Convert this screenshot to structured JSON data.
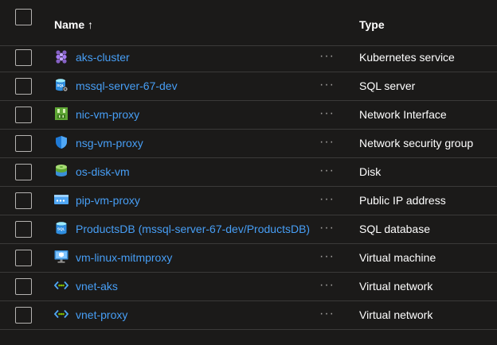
{
  "header": {
    "name_label": "Name",
    "sort_indicator": "↑",
    "type_label": "Type"
  },
  "more_glyph": "···",
  "rows": [
    {
      "name": "aks-cluster",
      "type": "Kubernetes service",
      "icon": "kubernetes-icon"
    },
    {
      "name": "mssql-server-67-dev",
      "type": "SQL server",
      "icon": "sql-server-icon"
    },
    {
      "name": "nic-vm-proxy",
      "type": "Network Interface",
      "icon": "network-interface-icon"
    },
    {
      "name": "nsg-vm-proxy",
      "type": "Network security group",
      "icon": "shield-icon"
    },
    {
      "name": "os-disk-vm",
      "type": "Disk",
      "icon": "disk-icon"
    },
    {
      "name": "pip-vm-proxy",
      "type": "Public IP address",
      "icon": "public-ip-icon"
    },
    {
      "name": "ProductsDB (mssql-server-67-dev/ProductsDB)",
      "type": "SQL database",
      "icon": "sql-database-icon"
    },
    {
      "name": "vm-linux-mitmproxy",
      "type": "Virtual machine",
      "icon": "virtual-machine-icon"
    },
    {
      "name": "vnet-aks",
      "type": "Virtual network",
      "icon": "virtual-network-icon"
    },
    {
      "name": "vnet-proxy",
      "type": "Virtual network",
      "icon": "virtual-network-icon"
    }
  ],
  "colors": {
    "background": "#1b1a19",
    "link": "#479ef5",
    "divider": "#3b3a39",
    "text": "#ffffff"
  }
}
